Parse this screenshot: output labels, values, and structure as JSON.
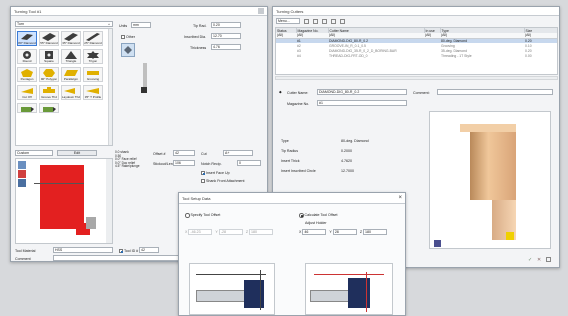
{
  "turning_tool": {
    "title": "Turning Tool #1",
    "type_select": "Turn",
    "units_label": "Units",
    "units_value": "mm",
    "tip_rad_label": "Tip Rad.",
    "tip_rad_value": "0.20",
    "other_label": "Other",
    "inscribed_dia_label": "Inscribed Dia.",
    "inscribed_dia_value": "12.70",
    "thickness_label": "Thickness",
    "thickness_value": "4.76",
    "shapes": [
      {
        "name": "80° Diamond"
      },
      {
        "name": "55° Diamond"
      },
      {
        "name": "35° Diamond"
      },
      {
        "name": "25° Diamond"
      },
      {
        "name": "Round"
      },
      {
        "name": "Square"
      },
      {
        "name": "Triangle"
      },
      {
        "name": "Trigon"
      },
      {
        "name": "Pentagon"
      },
      {
        "name": "90° Polygon"
      },
      {
        "name": "Parallelgm"
      },
      {
        "name": "Grooving"
      },
      {
        "name": "Cut Off"
      },
      {
        "name": "Groove Thd"
      },
      {
        "name": "Laydown Thd"
      },
      {
        "name": "35° T Profile"
      }
    ],
    "holder_select": "Custom",
    "edit_button": "Edit",
    "holder_desc": "0.0 shank\n0.50\n0.0° Face relief\n0.0° Doc relief\n4.5° Rake/plunge",
    "offset_label": "Offset #",
    "offset_value": "42",
    "cut_label": "Cut",
    "cut_value": "A+",
    "stickout_label": "Stickout/Len",
    "stickout_value": "106",
    "notch_label": "Notch Recip.",
    "notch_value": "0",
    "insert_face_up": "Insert Face Up",
    "shank_front": "Shank Front Attachment",
    "tool_material_label": "Tool Material",
    "tool_material_value": "HSS",
    "tool_id_label": "Tool ID #",
    "tool_id_value": "42",
    "comment_label": "Comment"
  },
  "turning_cutters": {
    "title": "Turning Cutters",
    "menu": "Menu...",
    "columns": [
      "Status",
      "Magazine No.",
      "Cutter Name",
      "In use",
      "Type",
      "Size"
    ],
    "filter": [
      "(All)",
      "(All)",
      "(All)",
      "(All)",
      "(All)",
      "(All)"
    ],
    "rows": [
      {
        "status": "",
        "mag": "#1",
        "name": "DIAMOND-DIG_80-R_0.2",
        "inuse": "",
        "type": "80-deg. Diamond",
        "size": "0.20"
      },
      {
        "status": "",
        "mag": "#2",
        "name": "GROOVE-IN_R_0.1_0.5",
        "inuse": "",
        "type": "Grooving",
        "size": "0.10"
      },
      {
        "status": "",
        "mag": "#3",
        "name": "DIAMOND-DIG_35-R_0_2_D_BORING-BAR",
        "inuse": "",
        "type": "35-deg. Diamond",
        "size": "0.20"
      },
      {
        "status": "",
        "mag": "#4",
        "name": "THREAD-DIG-FRT-OD_0",
        "inuse": "",
        "type": "Threading - 1T Style",
        "size": "0.00"
      }
    ],
    "cutter_name_label": "Cutter Name:",
    "cutter_name_value": "DIAMOND-DIG_80-R_0.2",
    "comment_label": "Comment:",
    "magazine_no_label": "Magazine No.",
    "magazine_no_value": "#1",
    "props": [
      {
        "k": "Type",
        "v": "80-deg. Diamond"
      },
      {
        "k": "Tip Radius",
        "v": "0.2000"
      },
      {
        "k": "Insert Thick",
        "v": "4.7620"
      },
      {
        "k": "Insert Inscribed Circle",
        "v": "12.7000"
      }
    ],
    "ok_symbol": "✓",
    "cancel_symbol": "✕"
  },
  "tool_setup": {
    "title": "Tool Setup Data",
    "close": "×",
    "specify_label": "Specify Tool Offset",
    "calculate_label": "Calculate Tool Offset",
    "adjust_holder_label": "Adjust Holder",
    "left_fields": [
      {
        "k": "X",
        "v": "-46.23"
      },
      {
        "k": "Y",
        "v": "-28"
      },
      {
        "k": "Z",
        "v": "180"
      }
    ],
    "right_fields": [
      {
        "k": "X",
        "v": "46"
      },
      {
        "k": "Y",
        "v": "28"
      },
      {
        "k": "Z",
        "v": "180"
      }
    ]
  },
  "colors": {
    "accent": "#3b7bd6",
    "tool_red": "#e32020",
    "insert_yellow": "#f0d000",
    "holder_peach": "#e8b48a"
  }
}
